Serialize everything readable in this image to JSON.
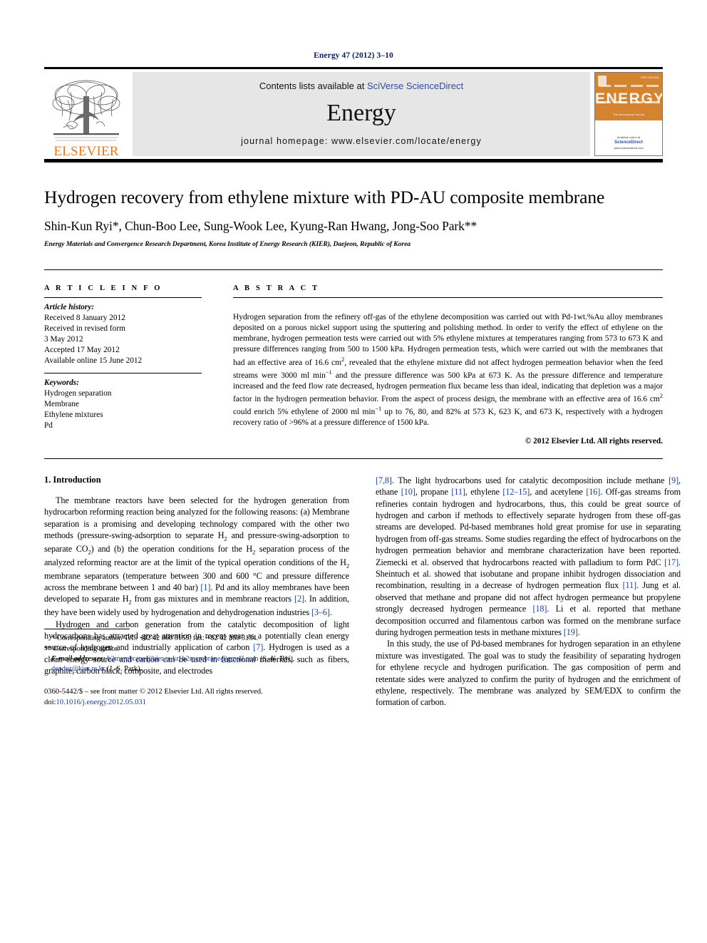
{
  "running_head": "Energy 47 (2012) 3–10",
  "masthead": {
    "publisher_name": "ELSEVIER",
    "contents_prefix": "Contents lists available at ",
    "contents_link": "SciVerse ScienceDirect",
    "journal_name": "Energy",
    "homepage": "journal homepage: www.elsevier.com/locate/energy",
    "cover": {
      "title": "ENERGY",
      "subtitle": "The International Journal",
      "issue_label": "ISSN 0360-5442",
      "foot_prefix": "Available online at",
      "foot_link": "ScienceDirect",
      "foot_url": "www.sciencedirect.com"
    }
  },
  "article": {
    "title": "Hydrogen recovery from ethylene mixture with PD-AU composite membrane",
    "authors": "Shin-Kun Ryi*, Chun-Boo Lee, Sung-Wook Lee, Kyung-Ran Hwang, Jong-Soo Park**",
    "affiliation": "Energy Materials and Convergence Research Department, Korea Institute of Energy Research (KIER), Daejeon, Republic of Korea"
  },
  "article_info": {
    "heading": "A R T I C L E   I N F O",
    "history_label": "Article history:",
    "history": [
      "Received 8 January 2012",
      "Received in revised form",
      "3 May 2012",
      "Accepted 17 May 2012",
      "Available online 15 June 2012"
    ],
    "keywords_label": "Keywords:",
    "keywords": [
      "Hydrogen separation",
      "Membrane",
      "Ethylene mixtures",
      "Pd"
    ]
  },
  "abstract": {
    "heading": "A B S T R A C T",
    "text": "Hydrogen separation from the refinery off-gas of the ethylene decomposition was carried out with Pd-1wt.%Au alloy membranes deposited on a porous nickel support using the sputtering and polishing method. In order to verify the effect of ethylene on the membrane, hydrogen permeation tests were carried out with 5% ethylene mixtures at temperatures ranging from 573 to 673 K and pressure differences ranging from 500 to 1500 kPa. Hydrogen permeation tests, which were carried out with the membranes that had an effective area of 16.6 cm2, revealed that the ethylene mixture did not affect hydrogen permeation behavior when the feed streams were 3000 ml min-1 and the pressure difference was 500 kPa at 673 K. As the pressure difference and temperature increased and the feed flow rate decreased, hydrogen permeation flux became less than ideal, indicating that depletion was a major factor in the hydrogen permeation behavior. From the aspect of process design, the membrane with an effective area of 16.6 cm2 could enrich 5% ethylene of 2000 ml min-1 up to 76, 80, and 82% at 573 K, 623 K, and 673 K, respectively with a hydrogen recovery ratio of >96% at a pressure difference of 1500 kPa.",
    "copyright": "© 2012 Elsevier Ltd. All rights reserved."
  },
  "body": {
    "section_number_title": "1.  Introduction",
    "left_paragraphs": [
      "The membrane reactors have been selected for the hydrogen generation from hydrocarbon reforming reaction being analyzed for the following reasons: (a) Membrane separation is a promising and developing technology compared with the other two methods (pressure-swing-adsorption to separate H2 and pressure-swing-adsorption to separate CO2) and (b) the operation conditions for the H2 separation process of the analyzed reforming reactor are at the limit of the typical operation conditions of the H2 membrane separators (temperature between 300 and 600 °C and pressure difference across the membrane between 1 and 40 bar) [1]. Pd and its alloy membranes have been developed to separate H2 from gas mixtures and in membrane reactors [2]. In addition, they have been widely used by hydrogenation and dehydrogenation industries [3–6].",
      "Hydrogen and carbon generation from the catalytic decomposition of light hydrocarbons has attracted great attention in recent year as a potentially clean energy source of hydrogen and industrially application of carbon [7]. Hydrogen is used as a clean energy source and carbon can be used in functional materials, such as fibers, graphite, carbon black, composite, and electrodes"
    ],
    "right_paragraphs": [
      "[7,8]. The light hydrocarbons used for catalytic decomposition include methane [9], ethane [10], propane [11], ethylene [12–15], and acetylene [16]. Off-gas streams from refineries contain hydrogen and hydrocarbons, thus, this could be great source of hydrogen and carbon if methods to effectively separate hydrogen from these off-gas streams are developed. Pd-based membranes hold great promise for use in separating hydrogen from off-gas streams. Some studies regarding the effect of hydrocarbons on the hydrogen permeation behavior and membrane characterization have been reported. Ziemecki et al. observed that hydrocarbons reacted with palladium to form PdC [17]. Sheintuch et al. showed that isobutane and propane inhibit hydrogen dissociation and recombination, resulting in a decrease of hydrogen permeation flux [11]. Jung et al. observed that methane and propane did not affect hydrogen permeance but propylene strongly decreased hydrogen permeance [18]. Li et al. reported that methane decomposition occurred and filamentous carbon was formed on the membrane surface during hydrogen permeation tests in methane mixtures [19].",
      "In this study, the use of Pd-based membranes for hydrogen separation in an ethylene mixture was investigated. The goal was to study the feasibility of separating hydrogen for ethylene recycle and hydrogen purification. The gas composition of perm and retentate sides were analyzed to confirm the purity of hydrogen and the enrichment of ethylene, respectively. The membrane was analyzed by SEM/EDX to confirm the formation of carbon."
    ]
  },
  "footnotes": {
    "line1": "* Corresponding author. Tel.: +82 42 860 3155; fax: +82 42 860 3134.",
    "line2": "** Corresponding author.",
    "email_label": "E-mail addresses:",
    "email1": "h2membrane@kier.re.kr",
    "email2": "h2membrane@gmail.com",
    "email1_owner": "(S.-K. Ryi),",
    "email3": "deodor@kier.re.kr",
    "email3_owner": "(J.-S. Park).",
    "issn_line": "0360-5442/$ – see front matter © 2012 Elsevier Ltd. All rights reserved.",
    "doi_label": "doi:",
    "doi_value": "10.1016/j.energy.2012.05.031"
  },
  "colors": {
    "link": "#1a3fa0",
    "running_head": "#0d1a6b",
    "elsevier_orange": "#E87722",
    "cover_orange": "#D4842E",
    "banner_gray": "#e6e6e6"
  }
}
